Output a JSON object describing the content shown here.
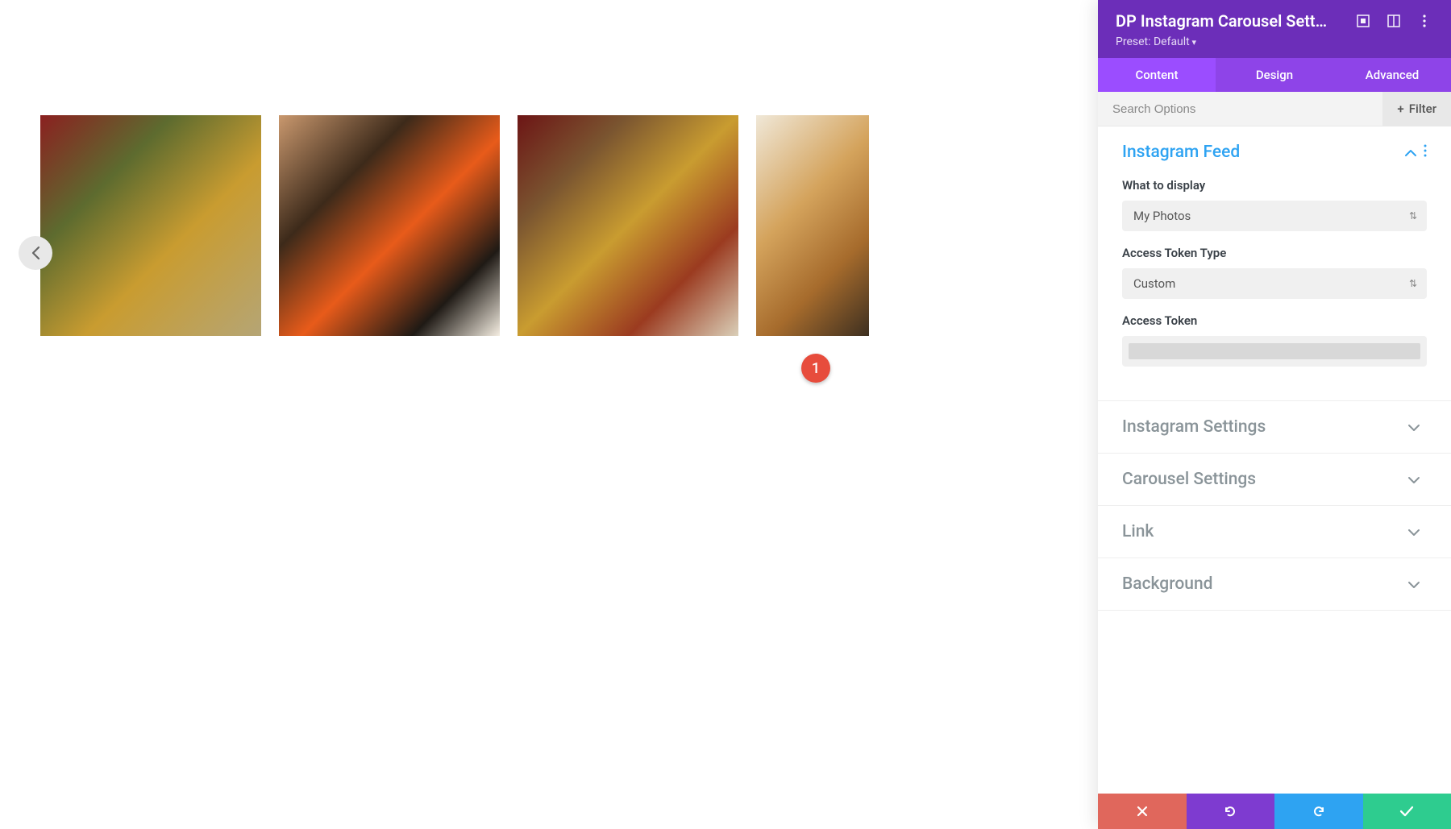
{
  "callout": {
    "number": "1"
  },
  "panel": {
    "title": "DP Instagram Carousel Sett…",
    "preset": "Preset: Default"
  },
  "tabs": {
    "content": "Content",
    "design": "Design",
    "advanced": "Advanced"
  },
  "search": {
    "placeholder": "Search Options",
    "filter": "Filter"
  },
  "sections": {
    "instagram_feed": {
      "title": "Instagram Feed",
      "fields": {
        "what_to_display": {
          "label": "What to display",
          "value": "My Photos"
        },
        "access_token_type": {
          "label": "Access Token Type",
          "value": "Custom"
        },
        "access_token": {
          "label": "Access Token"
        }
      }
    },
    "instagram_settings": {
      "title": "Instagram Settings"
    },
    "carousel_settings": {
      "title": "Carousel Settings"
    },
    "link": {
      "title": "Link"
    },
    "background": {
      "title": "Background"
    }
  }
}
